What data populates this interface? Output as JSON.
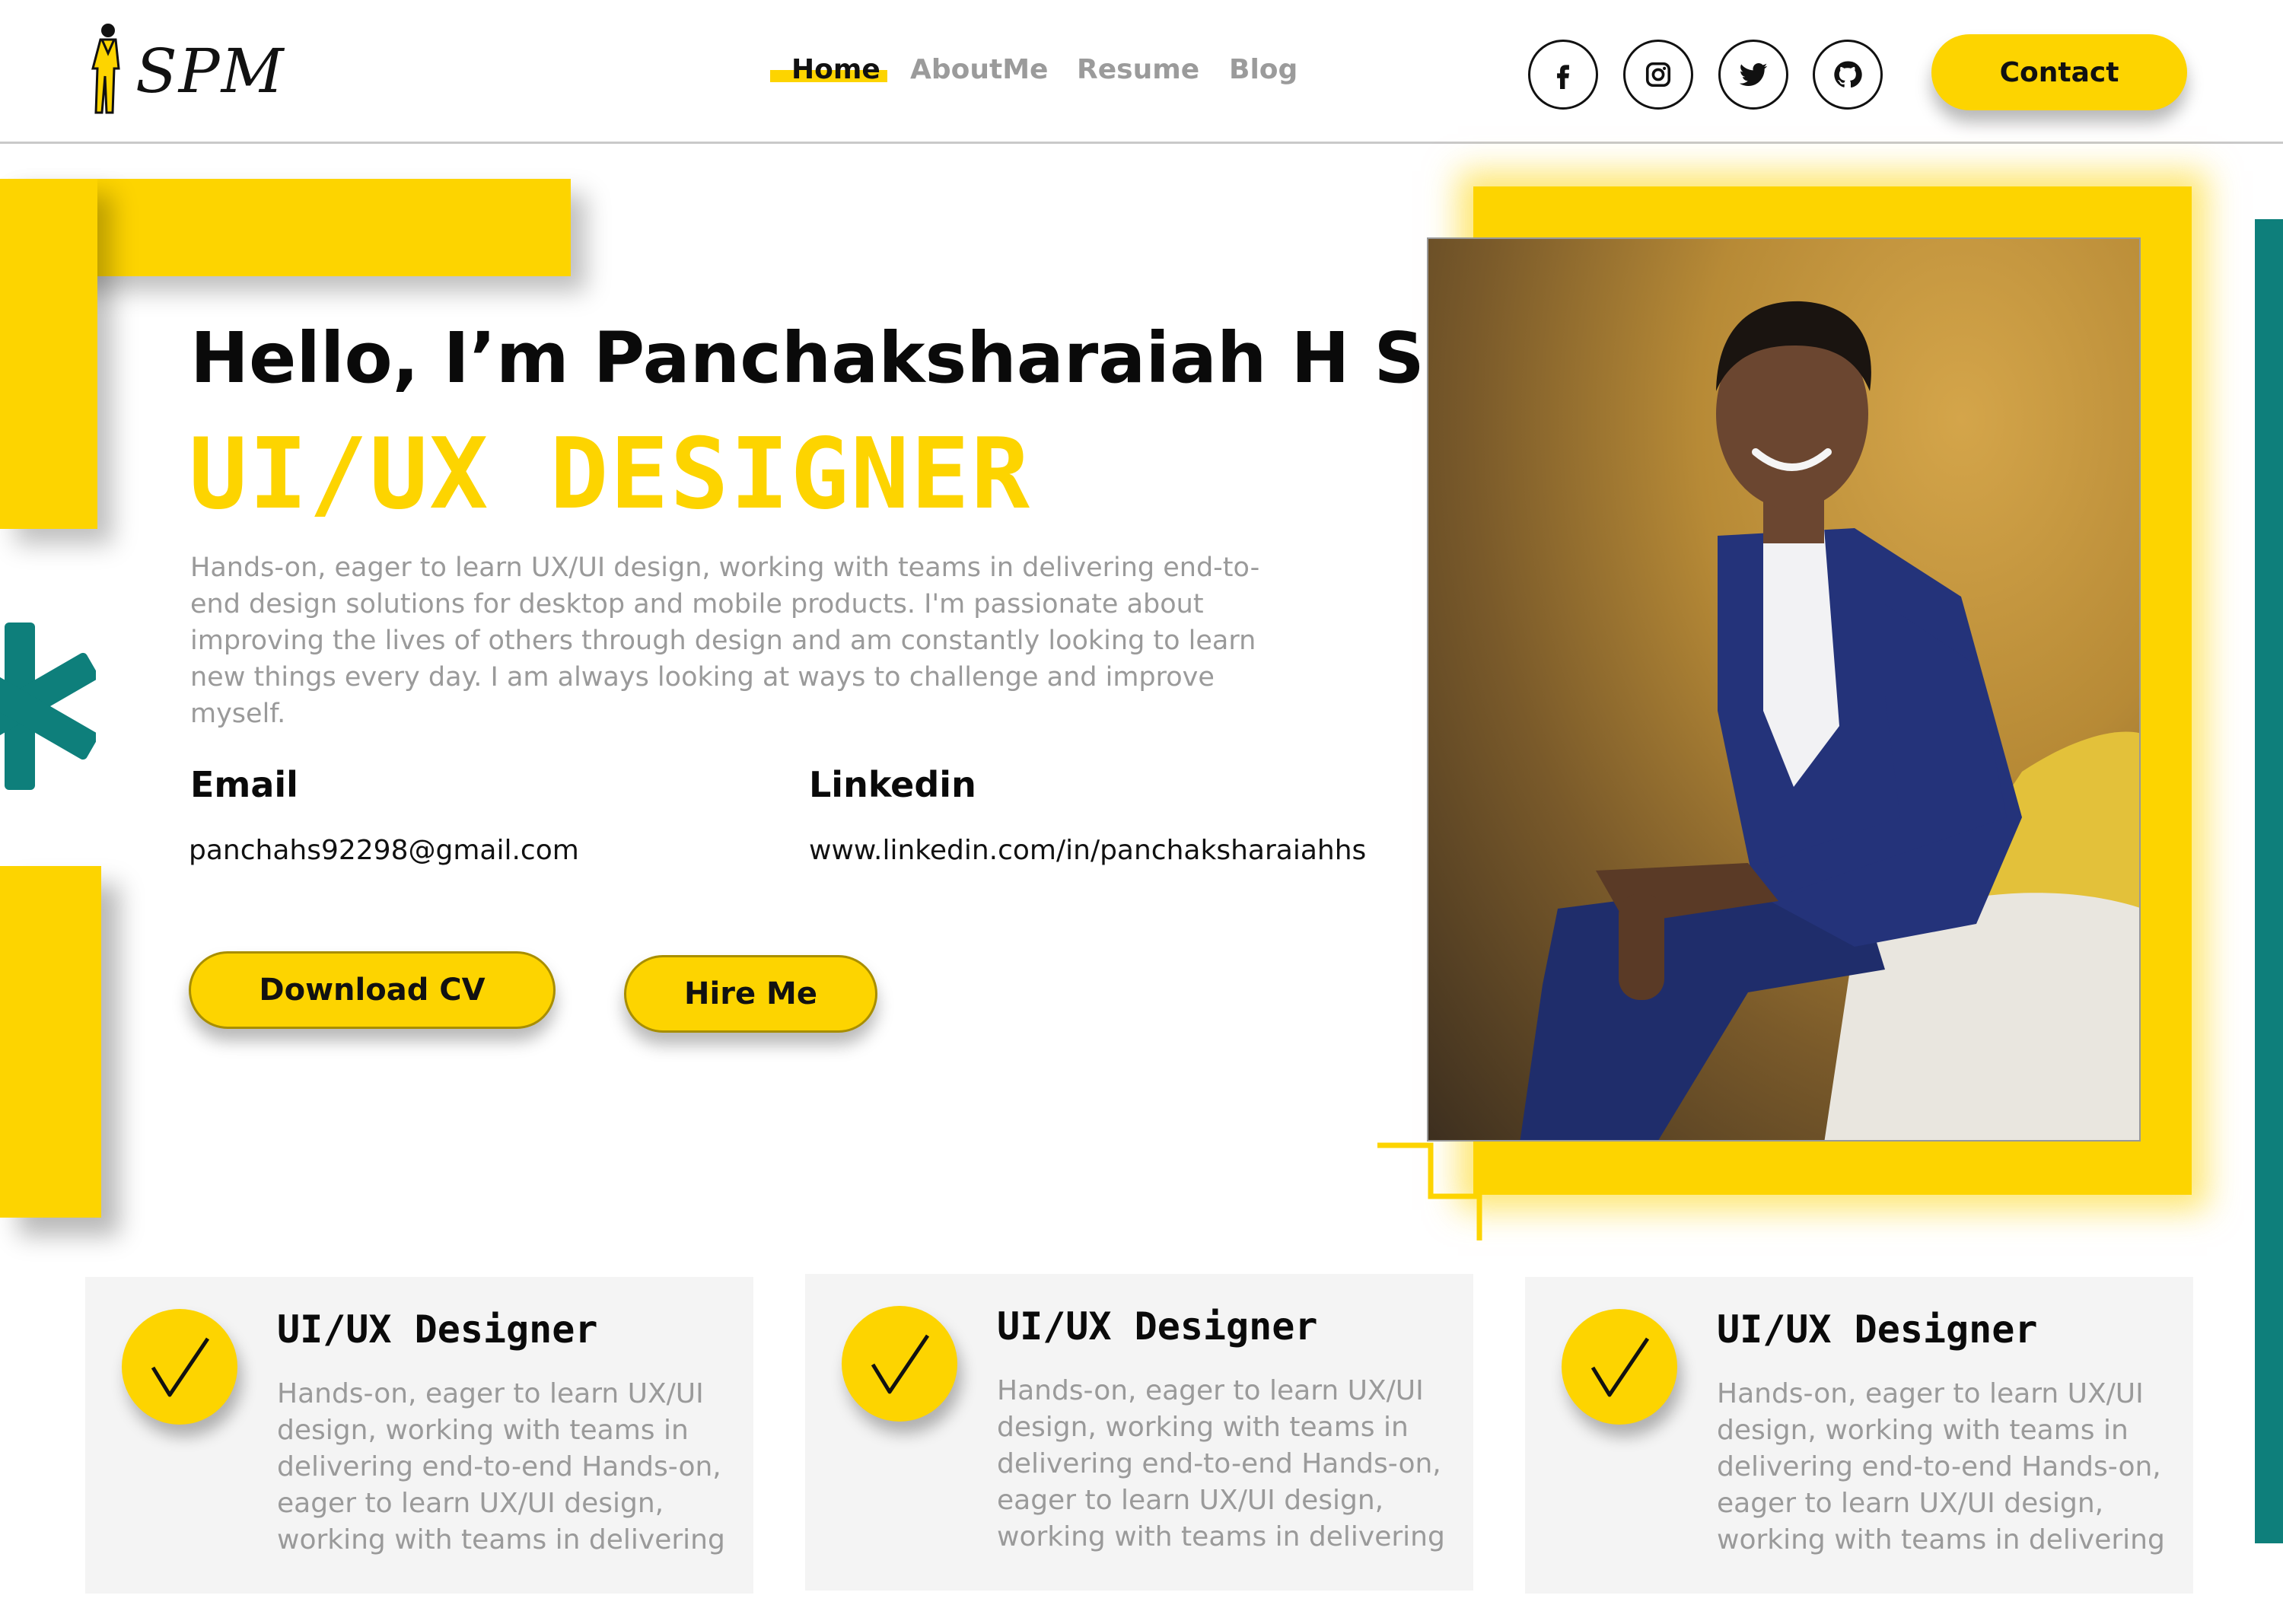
{
  "brand": {
    "logo_text": "SPM"
  },
  "nav": {
    "items": [
      {
        "label": "Home",
        "active": true
      },
      {
        "label": "AboutMe",
        "active": false
      },
      {
        "label": "Resume",
        "active": false
      },
      {
        "label": "Blog",
        "active": false
      }
    ]
  },
  "social": {
    "icons": [
      "facebook-icon",
      "instagram-icon",
      "twitter-icon",
      "github-icon"
    ]
  },
  "header": {
    "contact_label": "Contact"
  },
  "hero": {
    "greeting": "Hello, I’m Panchaksharaiah H S",
    "role": "UI/UX DESIGNER",
    "description": "Hands-on, eager to learn UX/UI design, working with teams in delivering end-to-end design solutions for desktop and mobile products. I'm passionate about improving the lives of others through design and am constantly looking to learn new things every day. I am always looking at ways to challenge and improve myself.",
    "email": {
      "label": "Email",
      "value": "panchahs92298@gmail.com"
    },
    "linkedin": {
      "label": "Linkedin",
      "value": "www.linkedin.com/in/panchaksharaiahhs"
    },
    "download_label": "Download CV",
    "hire_label": "Hire Me"
  },
  "cards": [
    {
      "title": "UI/UX Designer",
      "text": "Hands-on, eager to learn UX/UI design, working with teams in delivering end-to-end Hands-on, eager to learn UX/UI design, working with teams in delivering"
    },
    {
      "title": "UI/UX Designer",
      "text": "Hands-on, eager to learn UX/UI design, working with teams in delivering end-to-end Hands-on, eager to learn UX/UI design, working with teams in delivering"
    },
    {
      "title": "UI/UX Designer",
      "text": "Hands-on, eager to learn UX/UI design, working with teams in delivering end-to-end Hands-on, eager to learn UX/UI design, working with teams in delivering"
    }
  ],
  "colors": {
    "accent": "#fdd400",
    "teal": "#0e7f7b",
    "muted_text": "#9a9a9a",
    "card_bg": "#f4f4f4"
  }
}
